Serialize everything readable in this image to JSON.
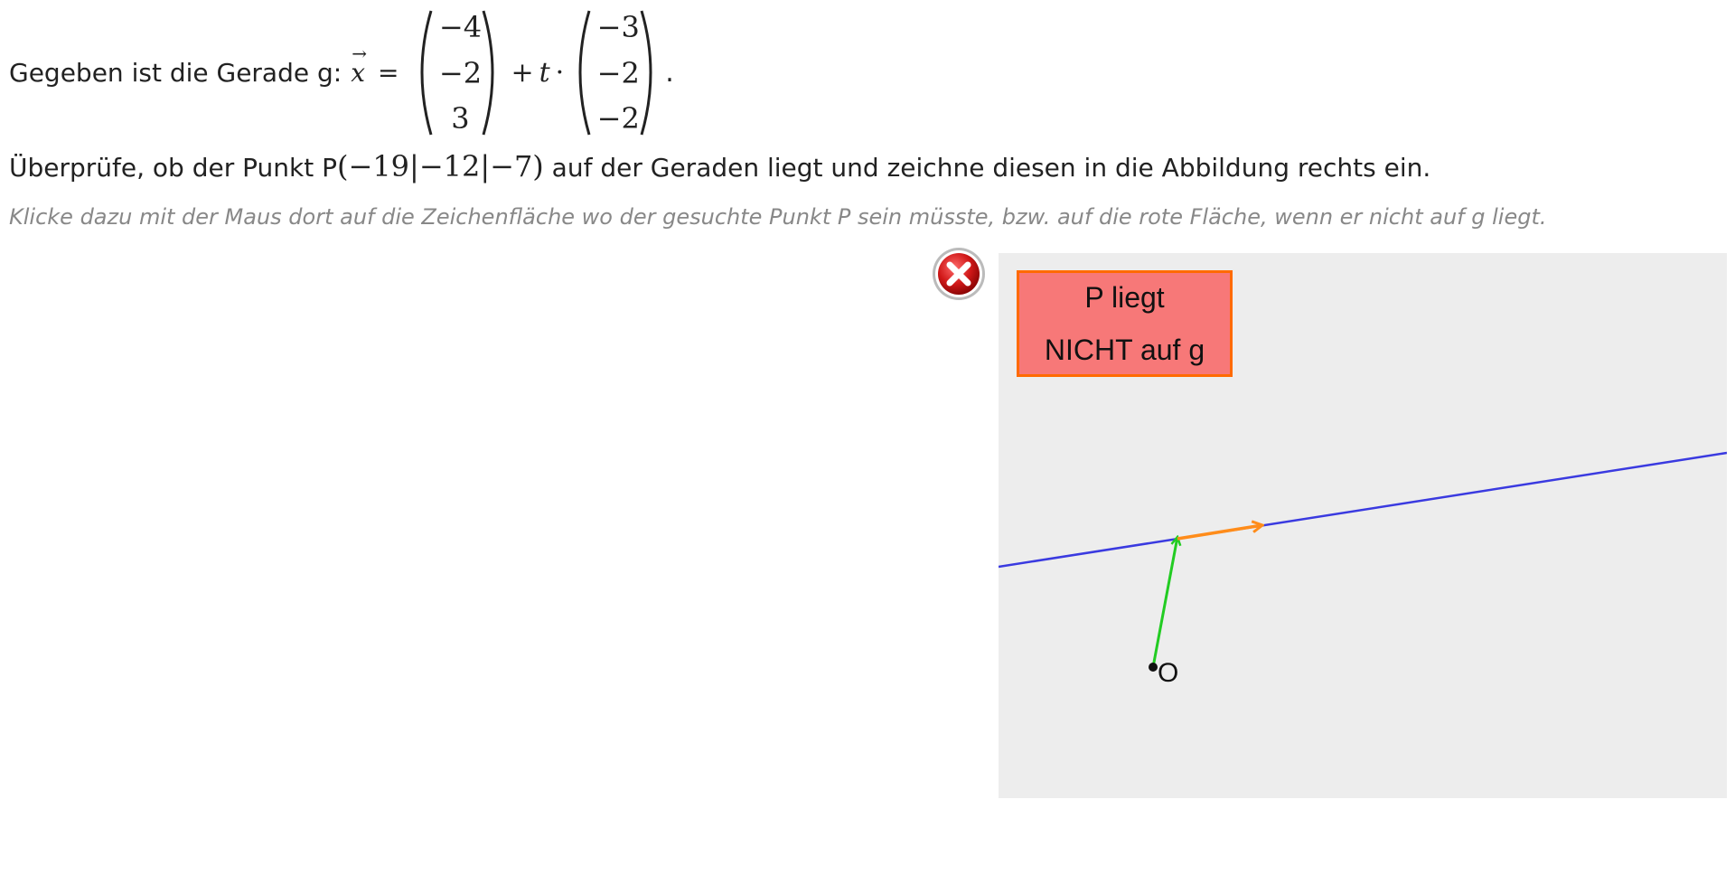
{
  "task": {
    "intro": "Gegeben ist die Gerade g:",
    "vector_symbol": "x",
    "equals": "=",
    "support_vector": [
      "−4",
      "−2",
      "3"
    ],
    "plus": "+",
    "param": "t",
    "dot": "·",
    "direction_vector": [
      "−3",
      "−2",
      "−2"
    ],
    "period": ".",
    "question_before": "Überprüfe, ob der Punkt P",
    "point": "(−19|−12|−7)",
    "question_after": " auf der Geraden liegt und zeichne diesen in die Abbildung rechts ein.",
    "hint": "Klicke dazu mit der Maus dort auf die Zeichenfläche wo der gesuchte Punkt P sein müsste, bzw. auf die rote Fläche, wenn er nicht auf g liegt."
  },
  "canvas": {
    "not_on_line_line1": "P liegt",
    "not_on_line_line2": "NICHT auf g",
    "origin_label": "O",
    "colors": {
      "background": "#ededed",
      "line_g": "#3a3ae0",
      "support_vector": "#22cc22",
      "direction_vector": "#ff8c1a",
      "not_box_fill": "#f77878",
      "not_box_border": "#ff6a00"
    }
  },
  "feedback": {
    "icon": "wrong-answer-icon",
    "color": "#cc1a1a"
  }
}
